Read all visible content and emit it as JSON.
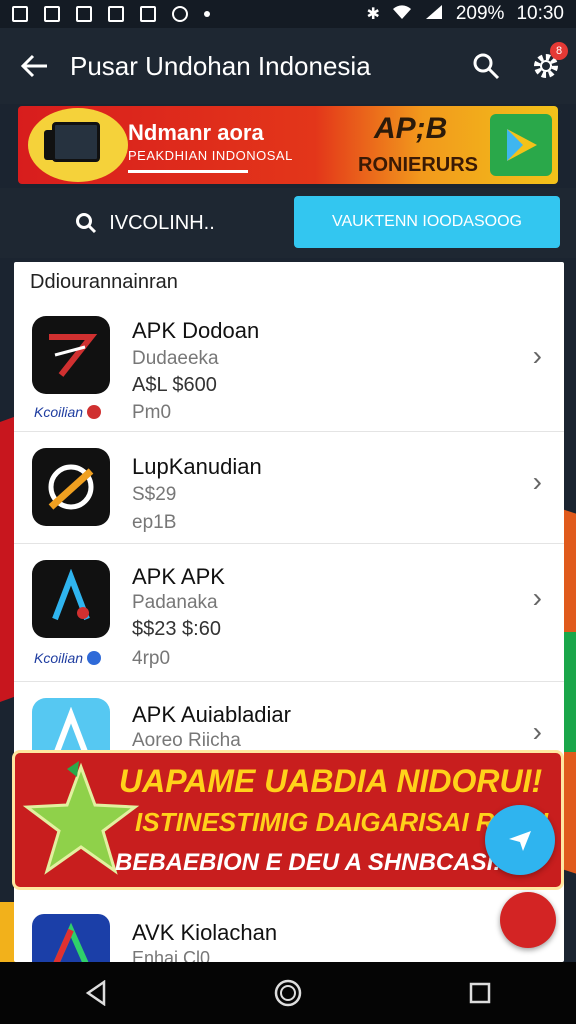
{
  "status_bar": {
    "battery": "209%",
    "time": "10:30"
  },
  "app_bar": {
    "title": "Pusar Undohan Indonesia",
    "badge": "8"
  },
  "banner": {
    "title": "Ndmanr aora",
    "subtitle": "PEAKDHIAN INDONOSAL",
    "apk": "AP;B",
    "apk_sub": "RONIERURS"
  },
  "tabs": {
    "search_label": "IVCOLINH..",
    "active_label": "VAUKTENN IOODASOOG"
  },
  "list": {
    "header": "Ddiourannainran",
    "items": [
      {
        "name": "APK Dodoan",
        "line1": "Dudaeeka",
        "price": "A$L $600",
        "line3": "Pm0",
        "tag": "Kcoilian",
        "icon_color": "#d03030"
      },
      {
        "name": "LupKanudian",
        "line1": "S$29",
        "price": "",
        "line3": "ep1B",
        "tag": "",
        "icon_color": "#f0a020"
      },
      {
        "name": "APK APK",
        "line1": "Padanaka",
        "price": "$$23 $:60",
        "line3": "4rp0",
        "tag": "Kcoilian",
        "icon_color": "#2fb4ef"
      },
      {
        "name": "APK Auiabladiar",
        "line1": "Aoreo Riicha",
        "price": "",
        "line3": "",
        "tag": "",
        "icon_color": "#56c8f2"
      },
      {
        "name": "AVK Kiolachan",
        "line1": "Enhai Cl0",
        "price": "",
        "line3": "",
        "tag": "",
        "icon_color": "#2a66d8"
      }
    ]
  },
  "promo": {
    "line1": "UAPAME UABDIA NIDORUI!",
    "line2": "ISTINESTIMIG DAIGARISAI RIIOH",
    "line3": "BEBAEBION E DEU A SHNBCASI!\""
  }
}
